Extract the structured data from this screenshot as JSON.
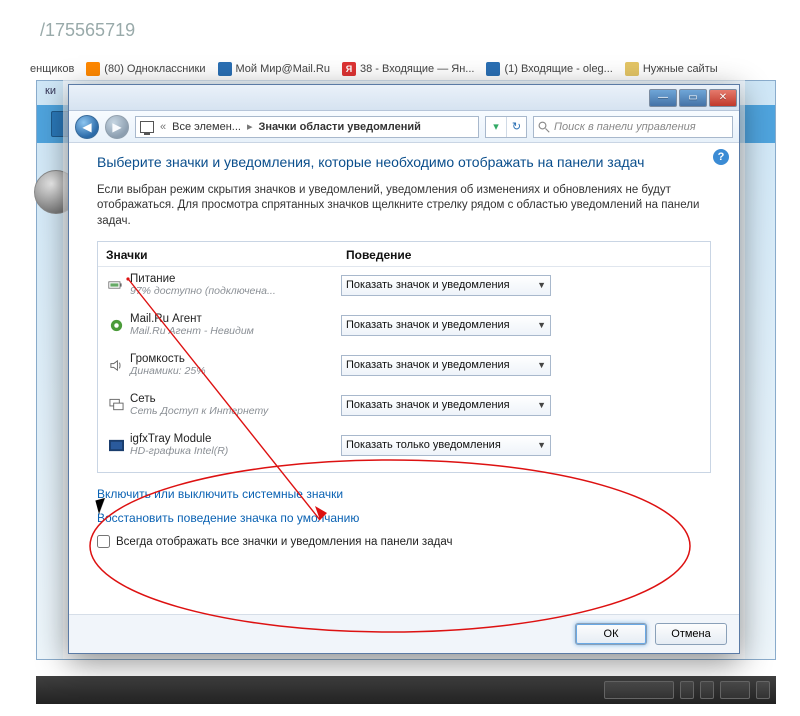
{
  "background": {
    "url_fragment": "/175565719",
    "bookmarks": [
      {
        "label": "енщиков",
        "icon": "generic"
      },
      {
        "label": "(80) Одноклассники",
        "icon": "ok"
      },
      {
        "label": "Мой Мир@Mail.Ru",
        "icon": "mail"
      },
      {
        "label": "38 - Входящие — Ян...",
        "icon": "ya"
      },
      {
        "label": "(1) Входящие - oleg...",
        "icon": "mail"
      },
      {
        "label": "Нужные сайты",
        "icon": "folder"
      }
    ],
    "tabstrip_fragment": "ки"
  },
  "window": {
    "sysbuttons": {
      "min": "—",
      "max": "▭",
      "close": "✕"
    },
    "nav": {
      "back_icon": "◀",
      "forward_icon": "▶",
      "breadcrumb1": "Все элемен...",
      "breadcrumb2": "Значки области уведомлений",
      "refresh_icon": "↻",
      "dropdown_icon": "▾",
      "search_placeholder": "Поиск в панели управления"
    },
    "help_icon": "?",
    "title": "Выберите значки и уведомления, которые необходимо отображать на панели задач",
    "description": "Если выбран режим скрытия значков и уведомлений, уведомления об изменениях и обновлениях не будут отображаться. Для просмотра спрятанных значков щелкните стрелку рядом с областью уведомлений на панели задач.",
    "columns": {
      "c1": "Значки",
      "c2": "Поведение"
    },
    "rows": [
      {
        "icon": "battery",
        "name": "Питание",
        "sub": "97% доступно (подключена...",
        "value": "Показать значок и уведомления"
      },
      {
        "icon": "mailru",
        "name": "Mail.Ru Агент",
        "sub": "Mail.Ru Агент - Невидим",
        "value": "Показать значок и уведомления"
      },
      {
        "icon": "volume",
        "name": "Громкость",
        "sub": "Динамики: 25%",
        "value": "Показать значок и уведомления"
      },
      {
        "icon": "network",
        "name": "Сеть",
        "sub": "Сеть Доступ к Интернету",
        "value": "Показать значок и уведомления"
      },
      {
        "icon": "intel",
        "name": "igfxTray Module",
        "sub": "HD-графика Intel(R)",
        "value": "Показать только уведомления"
      }
    ],
    "link1": "Включить или выключить системные значки",
    "link2": "Восстановить поведение значка по умолчанию",
    "checkbox_label": "Всегда отображать все значки и уведомления на панели задач",
    "footer": {
      "ok": "ОК",
      "cancel": "Отмена"
    }
  }
}
